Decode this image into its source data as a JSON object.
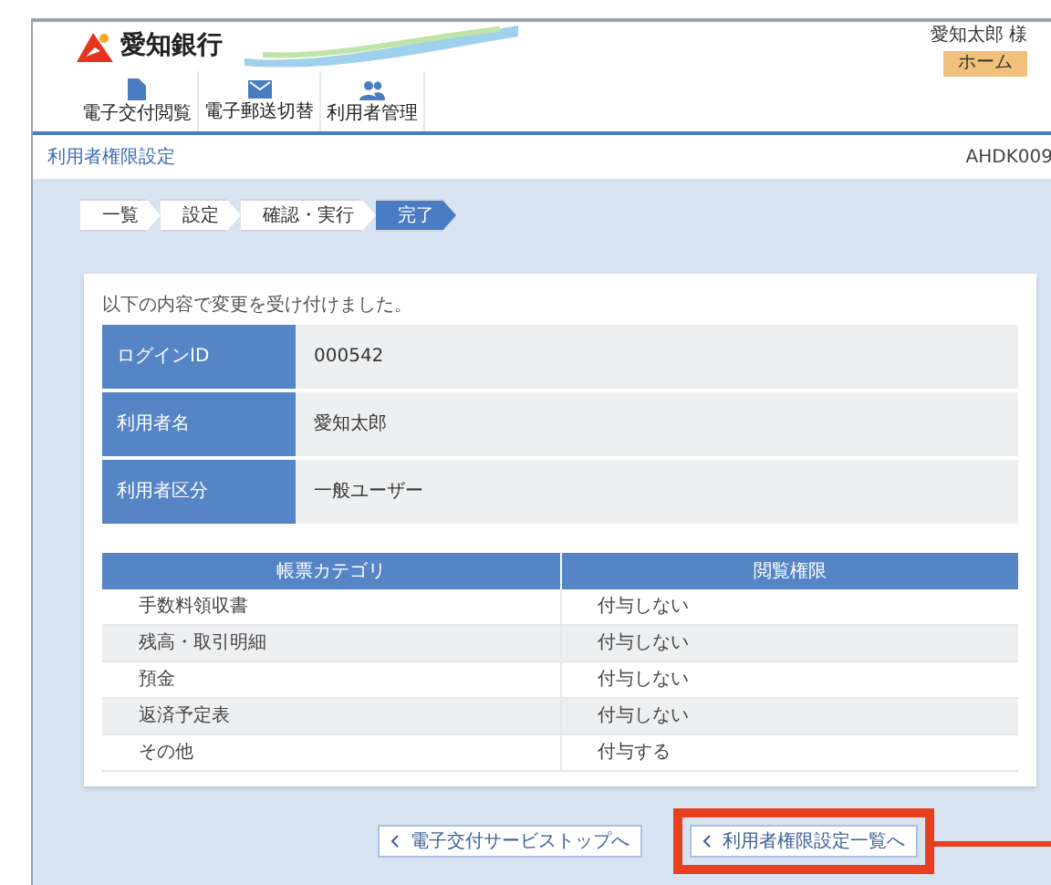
{
  "header": {
    "bank_name": "愛知銀行",
    "user": "愛知太郎 様",
    "home_button": "ホーム"
  },
  "nav": [
    {
      "label": "電子交付閲覧",
      "kind": "document",
      "selected": false
    },
    {
      "label": "電子郵送切替",
      "kind": "mail",
      "selected": false
    },
    {
      "label": "利用者管理",
      "kind": "users",
      "selected": false
    }
  ],
  "page": {
    "title": "利用者権限設定",
    "screen_id": "AHDK009"
  },
  "steps": [
    {
      "label": "一覧",
      "selected": false
    },
    {
      "label": "設定",
      "selected": false
    },
    {
      "label": "確認・実行",
      "selected": false
    },
    {
      "label": "完了",
      "selected": true
    }
  ],
  "message": "以下の内容で変更を受け付けました。",
  "info_rows": [
    {
      "label": "ログインID",
      "value": "000542"
    },
    {
      "label": "利用者名",
      "value": "愛知太郎"
    },
    {
      "label": "利用者区分",
      "value": "一般ユーザー"
    }
  ],
  "table": {
    "columns": [
      "帳票カテゴリ",
      "閲覧権限"
    ],
    "rows": [
      [
        "手数料領収書",
        "付与しない"
      ],
      [
        "残高・取引明細",
        "付与しない"
      ],
      [
        "預金",
        "付与しない"
      ],
      [
        "返済予定表",
        "付与しない"
      ],
      [
        "その他",
        "付与する"
      ]
    ]
  },
  "buttons": [
    {
      "label": "電子交付サービストップへ",
      "highlighted": false
    },
    {
      "label": "利用者権限設定一覧へ",
      "highlighted": true
    }
  ]
}
